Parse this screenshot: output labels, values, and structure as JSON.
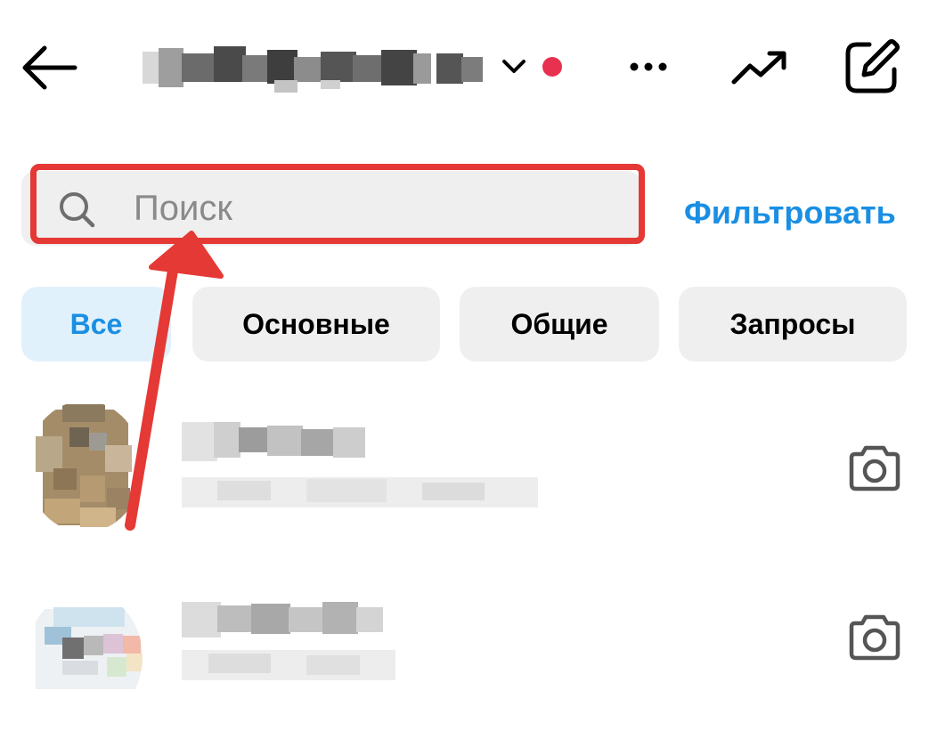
{
  "header": {
    "back_icon": "arrow-left-icon",
    "title_redacted": "",
    "account_switch_icon": "chevron-down-icon",
    "unread_dot_color": "#e8314f",
    "more_icon": "more-horizontal-icon",
    "activity_icon": "trending-up-icon",
    "compose_icon": "edit-square-icon"
  },
  "search": {
    "icon": "search-icon",
    "placeholder": "Поиск",
    "value": "",
    "highlight_color": "#e53935"
  },
  "filter_label": "Фильтровать",
  "tabs": [
    {
      "label": "Все",
      "active": true
    },
    {
      "label": "Основные",
      "active": false
    },
    {
      "label": "Общие",
      "active": false
    },
    {
      "label": "Запросы",
      "active": false
    }
  ],
  "threads": [
    {
      "name": "",
      "preview": "",
      "action_icon": "camera-icon"
    },
    {
      "name": "",
      "preview": "",
      "action_icon": "camera-icon"
    }
  ],
  "colors": {
    "accent": "#1a8fe3",
    "active_tab_bg": "#e1f1fc",
    "chip_bg": "#efefef",
    "annotation_red": "#e53935"
  }
}
